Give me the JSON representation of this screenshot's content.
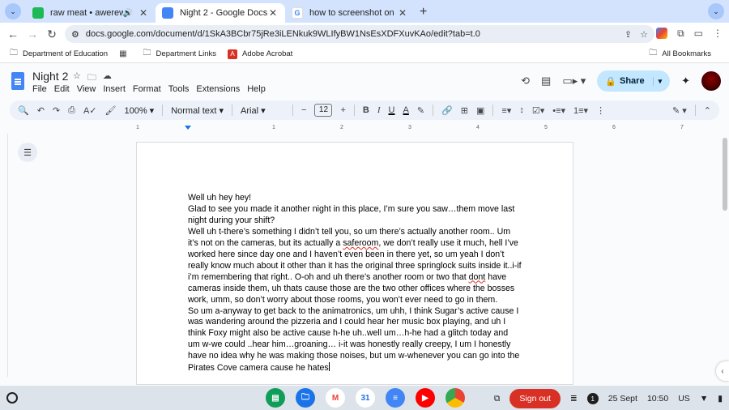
{
  "browser": {
    "tabs": [
      {
        "title": "raw meat • awerewa",
        "favicon": "spotify-icon",
        "audio": true
      },
      {
        "title": "Night 2 - Google Docs",
        "favicon": "docs-icon",
        "active": true
      },
      {
        "title": "how to screenshot on school, l",
        "favicon": "google-icon"
      }
    ],
    "url": "docs.google.com/document/d/1SkA3BCbr75jRe3iLENkuk9WLIfyBW1NsEsXDFXuvKAo/edit?tab=t.0"
  },
  "bookmarks": {
    "items": [
      {
        "label": "Department of Education",
        "icon": "folder-icon"
      },
      {
        "label": "",
        "icon": "apps-grid-icon"
      },
      {
        "label": "Department Links",
        "icon": "folder-icon"
      },
      {
        "label": "Adobe Acrobat",
        "icon": "pdf-icon"
      }
    ],
    "all_label": "All Bookmarks"
  },
  "docs": {
    "title": "Night 2",
    "menu": [
      "File",
      "Edit",
      "View",
      "Insert",
      "Format",
      "Tools",
      "Extensions",
      "Help"
    ],
    "share_label": "Share",
    "toolbar": {
      "zoom": "100%",
      "style": "Normal text",
      "font": "Arial",
      "font_size": "12"
    },
    "ruler_labels": [
      "1",
      "1",
      "2",
      "3",
      "4",
      "5",
      "6",
      "7"
    ]
  },
  "document": {
    "lines": [
      "Well uh hey hey!",
      "Glad to see you made it another night in this place, I’m sure you saw…them move last night during your shift?",
      "Well uh t-there’s something I didn’t tell you, so um there’s actually another room.. Um it’s not on the cameras, but its actually a saferoom, we don’t really use it much, hell I’ve worked here since day one and I haven’t even been in there yet, so um yeah I don’t really know much about it other than it has the original three springlock suits inside it..i-if i’m remembering that right.. O-oh and uh there’s another room or two that dont have cameras inside them, uh thats cause those are the two other offices where the bosses work, umm, so don’t worry about those rooms, you won’t ever need to go in them.",
      "So um a-anyway to get back to the animatronics, um uhh, I think Sugar’s active cause I was wandering around the pizzeria and I could hear her music box playing, and uh I think Foxy might also be active cause h-he uh..well um…h-he had a glitch today and um w-we could ..hear him…groaning… i-it was honestly really creepy, I um I honestly have no idea why he was making those noises, but um w-whenever you can go into the Pirates Cove camera cause he hates"
    ],
    "misspelled": [
      "saferoom",
      "dont"
    ]
  },
  "shelf": {
    "apps": [
      "classroom-icon",
      "files-icon",
      "gmail-icon",
      "calendar-icon",
      "docs-icon",
      "youtube-icon",
      "chrome-icon"
    ],
    "signout_label": "Sign out",
    "notifications": "1",
    "date": "25 Sept",
    "time": "10:50",
    "locale": "US"
  }
}
